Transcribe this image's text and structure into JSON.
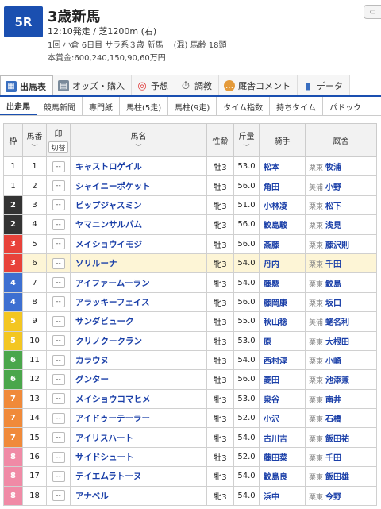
{
  "race": {
    "number": "5R",
    "title": "3歳新馬",
    "info1": "12:10発走 / 芝1200m (右)",
    "info2": "1回 小倉 6日目 サラ系３歳 新馬　 (混) 馬齢 18頭",
    "info3": "本賞金:600,240,150,90,60万円"
  },
  "tabs": [
    {
      "label": "出馬表",
      "icon": "table-icon",
      "active": true
    },
    {
      "label": "オッズ・購入",
      "icon": "ticket-icon"
    },
    {
      "label": "予想",
      "icon": "target-icon"
    },
    {
      "label": "調教",
      "icon": "stopwatch-icon"
    },
    {
      "label": "厩舎コメント",
      "icon": "chat-icon"
    },
    {
      "label": "データ",
      "icon": "bar-chart-icon"
    }
  ],
  "subtabs": [
    "出走馬",
    "競馬新聞",
    "専門紙",
    "馬柱(5走)",
    "馬柱(9走)",
    "タイム指数",
    "持ちタイム",
    "パドック"
  ],
  "table": {
    "headers": {
      "waku": "枠",
      "umaban": "馬番",
      "mark": "印",
      "mark_sub": "切替",
      "name": "馬名",
      "sexage": "性齢",
      "weight": "斤量",
      "jockey": "騎手",
      "trainer": "厩舎"
    },
    "waku_colors": {
      "1": "#ffffff",
      "2": "#333333",
      "3": "#e8423a",
      "4": "#3d6fd1",
      "5": "#f3c621",
      "6": "#4aa64b",
      "7": "#f08a3a",
      "8": "#f08aa6"
    },
    "rows": [
      {
        "waku": "1",
        "umaban": "1",
        "mark": "--",
        "name": "キャストロゲイル",
        "sexage": "牡3",
        "weight": "53.0",
        "jockey": "松本",
        "region": "栗東",
        "trainer": "牧浦"
      },
      {
        "waku": "1",
        "umaban": "2",
        "mark": "--",
        "name": "シャイニーポケット",
        "sexage": "牡3",
        "weight": "56.0",
        "jockey": "角田",
        "region": "美浦",
        "trainer": "小野"
      },
      {
        "waku": "2",
        "umaban": "3",
        "mark": "--",
        "name": "ビップジャスミン",
        "sexage": "牝3",
        "weight": "51.0",
        "jockey": "小林凌",
        "region": "栗東",
        "trainer": "松下"
      },
      {
        "waku": "2",
        "umaban": "4",
        "mark": "--",
        "name": "ヤマニンサルパム",
        "sexage": "牝3",
        "weight": "56.0",
        "jockey": "鮫島駿",
        "region": "栗東",
        "trainer": "浅見"
      },
      {
        "waku": "3",
        "umaban": "5",
        "mark": "--",
        "name": "メイショウイモジ",
        "sexage": "牡3",
        "weight": "56.0",
        "jockey": "斎藤",
        "region": "栗東",
        "trainer": "藤沢則"
      },
      {
        "waku": "3",
        "umaban": "6",
        "mark": "--",
        "name": "ソリルーナ",
        "sexage": "牝3",
        "weight": "54.0",
        "jockey": "丹内",
        "region": "栗東",
        "trainer": "千田",
        "highlight": true
      },
      {
        "waku": "4",
        "umaban": "7",
        "mark": "--",
        "name": "アイファームーラン",
        "sexage": "牝3",
        "weight": "54.0",
        "jockey": "藤懸",
        "region": "栗東",
        "trainer": "鮫島"
      },
      {
        "waku": "4",
        "umaban": "8",
        "mark": "--",
        "name": "アラッキーフェイス",
        "sexage": "牝3",
        "weight": "56.0",
        "jockey": "藤岡康",
        "region": "栗東",
        "trainer": "坂口"
      },
      {
        "waku": "5",
        "umaban": "9",
        "mark": "--",
        "name": "サンダビューク",
        "sexage": "牡3",
        "weight": "55.0",
        "jockey": "秋山稔",
        "region": "美浦",
        "trainer": "蛯名利"
      },
      {
        "waku": "5",
        "umaban": "10",
        "mark": "--",
        "name": "クリノクークラン",
        "sexage": "牡3",
        "weight": "53.0",
        "jockey": "原",
        "region": "栗東",
        "trainer": "大根田"
      },
      {
        "waku": "6",
        "umaban": "11",
        "mark": "--",
        "name": "カラウヌ",
        "sexage": "牡3",
        "weight": "54.0",
        "jockey": "西村淳",
        "region": "栗東",
        "trainer": "小崎"
      },
      {
        "waku": "6",
        "umaban": "12",
        "mark": "--",
        "name": "グンター",
        "sexage": "牡3",
        "weight": "56.0",
        "jockey": "菱田",
        "region": "栗東",
        "trainer": "池添兼"
      },
      {
        "waku": "7",
        "umaban": "13",
        "mark": "--",
        "name": "メイショウコマヒメ",
        "sexage": "牝3",
        "weight": "53.0",
        "jockey": "泉谷",
        "region": "栗東",
        "trainer": "南井"
      },
      {
        "waku": "7",
        "umaban": "14",
        "mark": "--",
        "name": "アイドゥーテーラー",
        "sexage": "牝3",
        "weight": "52.0",
        "jockey": "小沢",
        "region": "栗東",
        "trainer": "石橋"
      },
      {
        "waku": "7",
        "umaban": "15",
        "mark": "--",
        "name": "アイリスハート",
        "sexage": "牝3",
        "weight": "54.0",
        "jockey": "古川吉",
        "region": "栗東",
        "trainer": "飯田祐"
      },
      {
        "waku": "8",
        "umaban": "16",
        "mark": "--",
        "name": "サイドシュート",
        "sexage": "牡3",
        "weight": "52.0",
        "jockey": "藤田菜",
        "region": "栗東",
        "trainer": "千田"
      },
      {
        "waku": "8",
        "umaban": "17",
        "mark": "--",
        "name": "テイエムラトーヌ",
        "sexage": "牝3",
        "weight": "54.0",
        "jockey": "鮫島良",
        "region": "栗東",
        "trainer": "飯田雄"
      },
      {
        "waku": "8",
        "umaban": "18",
        "mark": "--",
        "name": "アナベル",
        "sexage": "牝3",
        "weight": "54.0",
        "jockey": "浜中",
        "region": "栗東",
        "trainer": "今野"
      }
    ]
  }
}
